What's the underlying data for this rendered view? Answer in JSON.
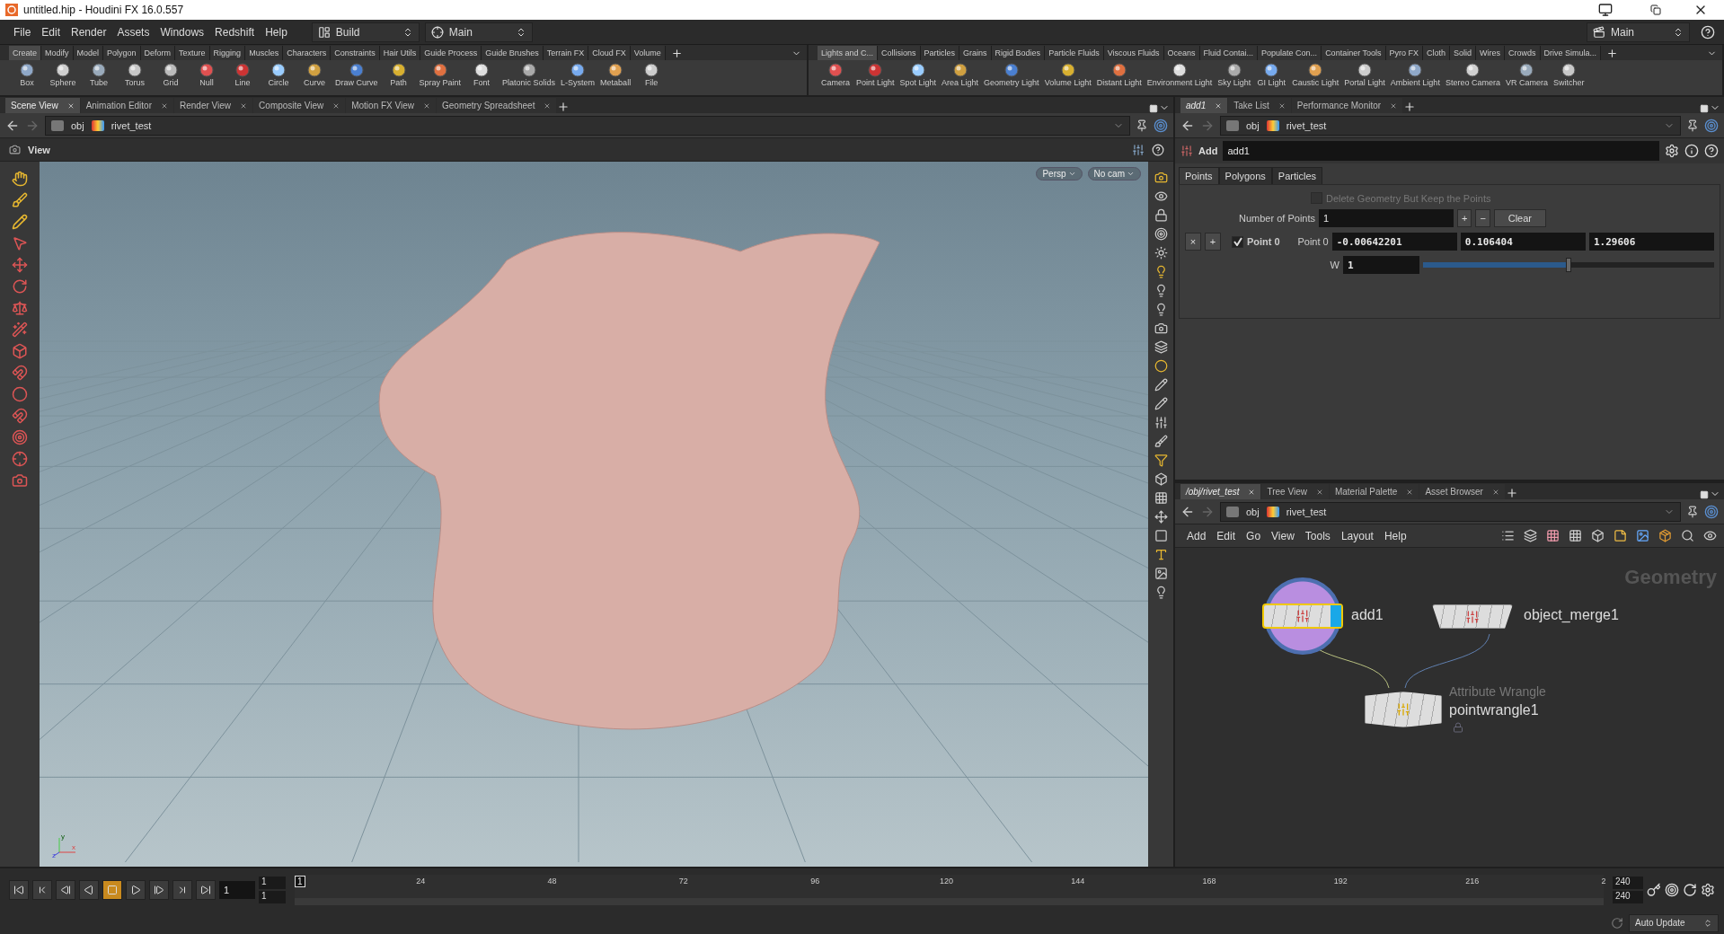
{
  "window": {
    "title": "untitled.hip - Houdini FX 16.0.557"
  },
  "menu_bar": {
    "items": [
      "File",
      "Edit",
      "Render",
      "Assets",
      "Windows",
      "Redshift",
      "Help"
    ],
    "desktop": "Build",
    "shelf_set": "Main",
    "right_shelf_set": "Main"
  },
  "shelf_left": {
    "tabs": [
      {
        "label": "Create",
        "selected": true
      },
      {
        "label": "Modify",
        "selected": false
      },
      {
        "label": "Model",
        "selected": false
      },
      {
        "label": "Polygon",
        "selected": false
      },
      {
        "label": "Deform",
        "selected": false
      },
      {
        "label": "Texture",
        "selected": false
      },
      {
        "label": "Rigging",
        "selected": false
      },
      {
        "label": "Muscles",
        "selected": false
      },
      {
        "label": "Characters",
        "selected": false
      },
      {
        "label": "Constraints",
        "selected": false
      },
      {
        "label": "Hair Utils",
        "selected": false
      },
      {
        "label": "Guide Process",
        "selected": false
      },
      {
        "label": "Guide Brushes",
        "selected": false
      },
      {
        "label": "Terrain FX",
        "selected": false
      },
      {
        "label": "Cloud FX",
        "selected": false
      },
      {
        "label": "Volume",
        "selected": false
      }
    ],
    "tools": [
      "Box",
      "Sphere",
      "Tube",
      "Torus",
      "Grid",
      "Null",
      "Line",
      "Circle",
      "Curve",
      "Draw Curve",
      "Path",
      "Spray Paint",
      "Font",
      "Platonic Solids",
      "L-System",
      "Metaball",
      "File"
    ]
  },
  "shelf_right": {
    "tabs": [
      {
        "label": "Lights and C...",
        "selected": true
      },
      {
        "label": "Collisions",
        "selected": false
      },
      {
        "label": "Particles",
        "selected": false
      },
      {
        "label": "Grains",
        "selected": false
      },
      {
        "label": "Rigid Bodies",
        "selected": false
      },
      {
        "label": "Particle Fluids",
        "selected": false
      },
      {
        "label": "Viscous Fluids",
        "selected": false
      },
      {
        "label": "Oceans",
        "selected": false
      },
      {
        "label": "Fluid Contai...",
        "selected": false
      },
      {
        "label": "Populate Con...",
        "selected": false
      },
      {
        "label": "Container Tools",
        "selected": false
      },
      {
        "label": "Pyro FX",
        "selected": false
      },
      {
        "label": "Cloth",
        "selected": false
      },
      {
        "label": "Solid",
        "selected": false
      },
      {
        "label": "Wires",
        "selected": false
      },
      {
        "label": "Crowds",
        "selected": false
      },
      {
        "label": "Drive Simula...",
        "selected": false
      }
    ],
    "tools": [
      "Camera",
      "Point Light",
      "Spot Light",
      "Area Light",
      "Geometry Light",
      "Volume Light",
      "Distant Light",
      "Environment Light",
      "Sky Light",
      "GI Light",
      "Caustic Light",
      "Portal Light",
      "Ambient Light",
      "Stereo Camera",
      "VR Camera",
      "Switcher"
    ]
  },
  "scene_pane": {
    "tabs": [
      {
        "label": "Scene View",
        "selected": true
      },
      {
        "label": "Animation Editor",
        "selected": false
      },
      {
        "label": "Render View",
        "selected": false
      },
      {
        "label": "Composite View",
        "selected": false
      },
      {
        "label": "Motion FX View",
        "selected": false
      },
      {
        "label": "Geometry Spreadsheet",
        "selected": false
      }
    ],
    "path": [
      "obj",
      "rivet_test"
    ],
    "viewport": {
      "title": "View",
      "camera_buttons": [
        "Persp",
        "No cam"
      ],
      "axes": [
        "y",
        "z",
        "x"
      ]
    }
  },
  "param_pane": {
    "tabs": [
      {
        "label": "add1",
        "selected": true
      },
      {
        "label": "Take List",
        "selected": false
      },
      {
        "label": "Performance Monitor",
        "selected": false
      }
    ],
    "path": [
      "obj",
      "rivet_test"
    ],
    "node_type": "Add",
    "node_name": "add1",
    "param_tabs": [
      {
        "label": "Points",
        "selected": true
      },
      {
        "label": "Polygons",
        "selected": false
      },
      {
        "label": "Particles",
        "selected": false
      }
    ],
    "delete_geometry": {
      "label": "Delete Geometry But Keep the Points",
      "checked": false,
      "disabled": true
    },
    "number_of_points": {
      "label": "Number of Points",
      "value": "1",
      "buttons": [
        "+",
        "−",
        "Clear"
      ]
    },
    "point": {
      "remove": "×",
      "add": "+",
      "enabled": true,
      "toggle_label": "Point 0",
      "label": "Point 0",
      "values": [
        "-0.00642201",
        "0.106404",
        "1.29606"
      ],
      "w_label": "W",
      "w_value": "1",
      "w_slider": {
        "level": 0.5
      }
    }
  },
  "network_pane": {
    "tabs": [
      {
        "label": "/obj/rivet_test",
        "selected": true
      },
      {
        "label": "Tree View",
        "selected": false
      },
      {
        "label": "Material Palette",
        "selected": false
      },
      {
        "label": "Asset Browser",
        "selected": false
      }
    ],
    "path": [
      "obj",
      "rivet_test"
    ],
    "menu": [
      "Add",
      "Edit",
      "Go",
      "View",
      "Tools",
      "Layout",
      "Help"
    ],
    "context": "Geometry",
    "nodes": [
      {
        "kind": "add",
        "name": "add1",
        "selected": true,
        "display": true
      },
      {
        "kind": "object_merge",
        "name": "object_merge1",
        "selected": false
      },
      {
        "kind": "wrangle",
        "name": "pointwrangle1",
        "type_label": "Attribute Wrangle",
        "selected": false,
        "locked": true
      }
    ]
  },
  "timeline": {
    "frame": "1",
    "range_start": [
      "1",
      "1"
    ],
    "range_end": [
      "240",
      "240"
    ],
    "current_marker": "1",
    "ticks": [
      "24",
      "48",
      "72",
      "96",
      "120",
      "144",
      "168",
      "192",
      "216",
      "2"
    ]
  },
  "status_bar": {
    "update_mode": "Auto Update"
  }
}
